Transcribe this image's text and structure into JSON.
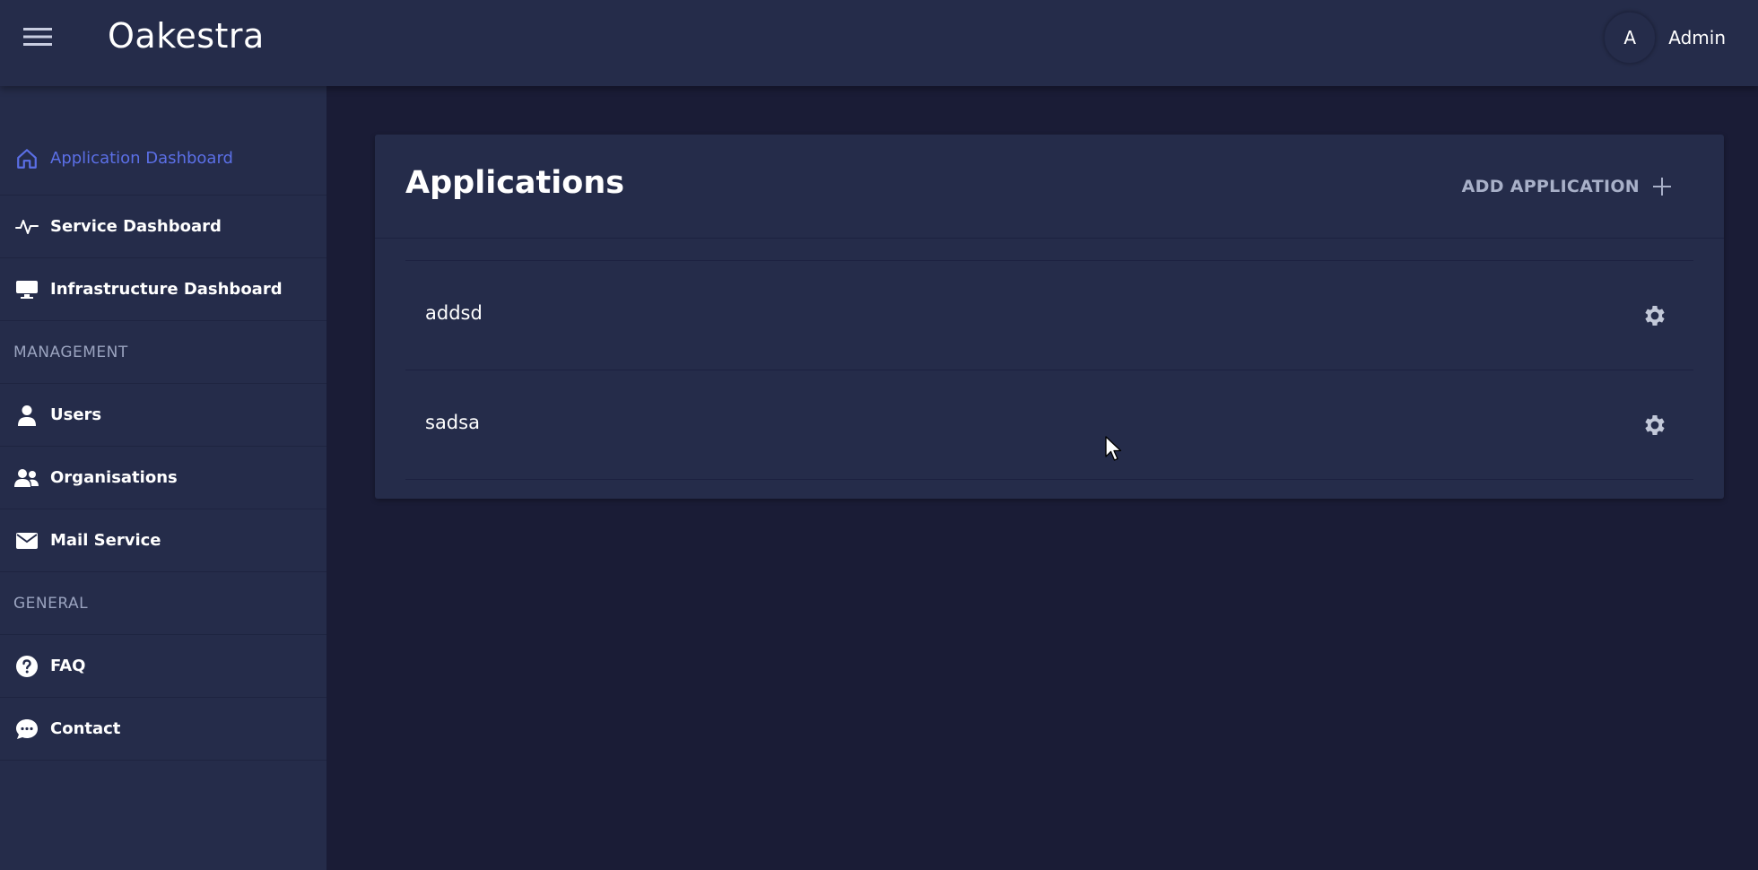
{
  "header": {
    "title": "Oakestra",
    "avatar_initial": "A",
    "username": "Admin"
  },
  "sidebar": {
    "items": [
      {
        "label": "Application Dashboard",
        "icon": "home-icon",
        "active": true
      },
      {
        "label": "Service Dashboard",
        "icon": "activity-icon"
      },
      {
        "label": "Infrastructure Dashboard",
        "icon": "monitor-icon"
      }
    ],
    "management_label": "MANAGEMENT",
    "management_items": [
      {
        "label": "Users",
        "icon": "user-icon"
      },
      {
        "label": "Organisations",
        "icon": "group-icon"
      },
      {
        "label": "Mail Service",
        "icon": "envelope-icon"
      }
    ],
    "general_label": "GENERAL",
    "general_items": [
      {
        "label": "FAQ",
        "icon": "question-icon"
      },
      {
        "label": "Contact",
        "icon": "chat-icon"
      }
    ]
  },
  "main": {
    "title": "Applications",
    "add_label": "ADD APPLICATION",
    "applications": [
      {
        "name": "addsd"
      },
      {
        "name": "sadsa"
      }
    ]
  },
  "colors": {
    "background": "#1a1c36",
    "surface": "#252c4a",
    "accent": "#5b6fe6",
    "muted_text": "#9aa3bf"
  }
}
